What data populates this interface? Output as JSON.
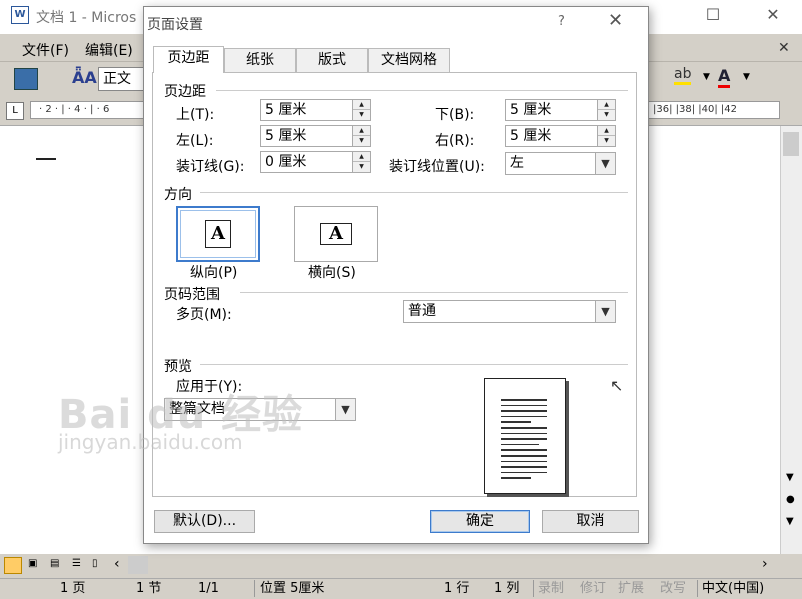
{
  "window": {
    "title": "文档 1 - Micros",
    "icon": "word-doc-icon"
  },
  "menu": {
    "file": "文件(F)",
    "edit": "编辑(E)"
  },
  "toolbar": {
    "style_value": "正文"
  },
  "ruler": {
    "left_ticks": "· 2 · | · 4 · | · 6",
    "right_ticks": "|36| |38| |40| |42"
  },
  "dialog": {
    "title": "页面设置",
    "help": "?",
    "tabs": [
      "页边距",
      "纸张",
      "版式",
      "文档网格"
    ],
    "margins": {
      "group": "页边距",
      "top_label": "上(T):",
      "top_value": "5 厘米",
      "bottom_label": "下(B):",
      "bottom_value": "5 厘米",
      "left_label": "左(L):",
      "left_value": "5 厘米",
      "right_label": "右(R):",
      "right_value": "5 厘米",
      "gutter_label": "装订线(G):",
      "gutter_value": "0 厘米",
      "gutter_pos_label": "装订线位置(U):",
      "gutter_pos_value": "左"
    },
    "orientation": {
      "group": "方向",
      "portrait_label": "纵向(P)",
      "landscape_label": "横向(S)",
      "glyph": "A"
    },
    "pages": {
      "group": "页码范围",
      "multi_label": "多页(M):",
      "multi_value": "普通"
    },
    "preview": {
      "group": "预览",
      "apply_label": "应用于(Y):",
      "apply_value": "整篇文档"
    },
    "buttons": {
      "default": "默认(D)...",
      "ok": "确定",
      "cancel": "取消"
    }
  },
  "watermark": {
    "line1": "Bai du 经验",
    "line2": "jingyan.baidu.com"
  },
  "status": {
    "page": "1 页",
    "section": "1 节",
    "pages": "1/1",
    "position": "位置 5厘米",
    "line": "1 行",
    "col": "1 列",
    "rec": "录制",
    "trk": "修订",
    "ext": "扩展",
    "ovr": "改写",
    "lang": "中文(中国)"
  }
}
